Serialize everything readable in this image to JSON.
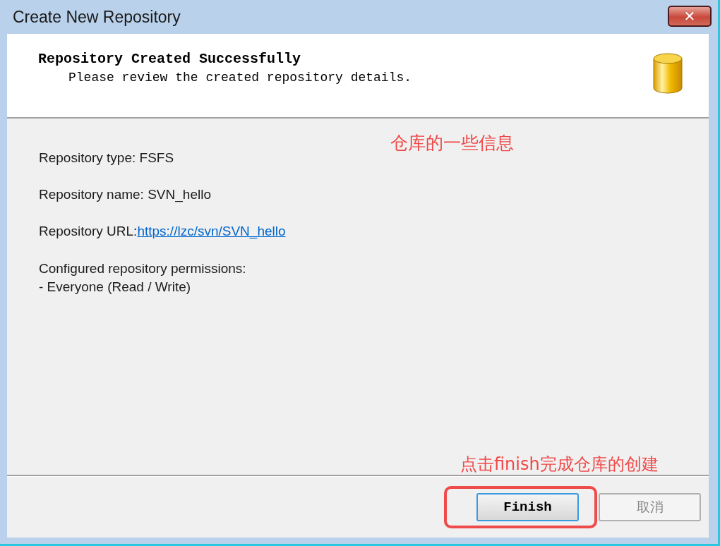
{
  "window": {
    "title": "Create New Repository",
    "close": "✕"
  },
  "header": {
    "title": "Repository Created Successfully",
    "subtitle": "Please review the created repository details."
  },
  "details": [
    {
      "kind": "text",
      "text": "Repository type: FSFS"
    },
    {
      "kind": "text",
      "text": "Repository name: SVN_hello"
    },
    {
      "kind": "link",
      "label": "Repository URL:",
      "link": "https://lzc/svn/SVN_hello"
    },
    {
      "kind": "list",
      "text": "Configured repository permissions:",
      "lines": [
        "- Everyone (Read / Write)"
      ]
    }
  ],
  "annotations": [
    {
      "text": "仓库的一些信息"
    },
    {
      "text": "点击finish完成仓库的创建"
    }
  ],
  "buttons": [
    {
      "label": "Finish",
      "disabled": false,
      "highlighted": true
    },
    {
      "label": "取消",
      "disabled": true,
      "highlighted": false
    }
  ]
}
